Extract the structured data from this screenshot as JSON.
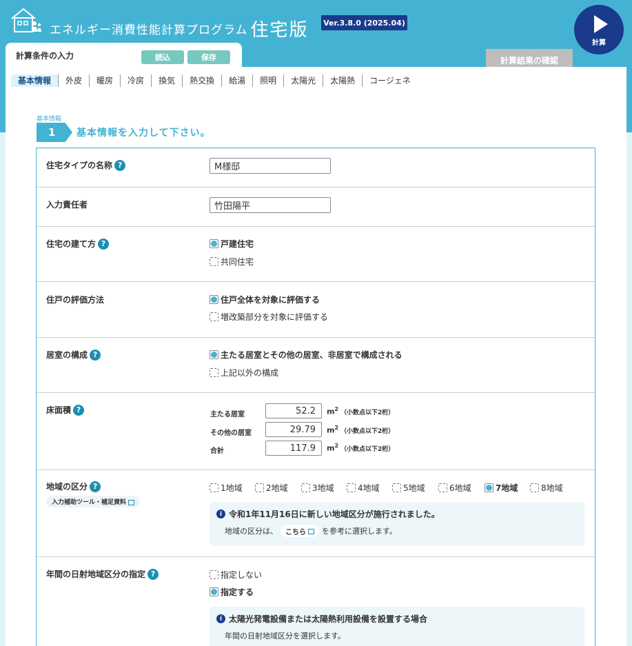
{
  "header": {
    "app_title": "エネルギー消費性能計算プログラム",
    "app_title_big": "住宅版",
    "version": "Ver.3.8.0 (2025.04)",
    "calc_button": "計算",
    "input_tab": "計算条件の入力",
    "load_button": "読込",
    "save_button": "保存",
    "result_button": "計算結果の確認"
  },
  "subtabs": [
    "基本情報",
    "外皮",
    "暖房",
    "冷房",
    "換気",
    "熱交換",
    "給湯",
    "照明",
    "太陽光",
    "太陽熱",
    "コージェネ"
  ],
  "section": {
    "small_label": "基本情報",
    "number": "1",
    "title": "基本情報を入力して下さい。"
  },
  "form": {
    "house_name": {
      "label": "住宅タイプの名称",
      "value": "M様邸"
    },
    "responsible": {
      "label": "入力責任者",
      "value": "竹田陽平"
    },
    "building_type": {
      "label": "住宅の建て方",
      "options": [
        "戸建住宅",
        "共同住宅"
      ]
    },
    "eval_method": {
      "label": "住戸の評価方法",
      "options": [
        "住戸全体を対象に評価する",
        "増改築部分を対象に評価する"
      ]
    },
    "room_config": {
      "label": "居室の構成",
      "options": [
        "主たる居室とその他の居室、非居室で構成される",
        "上記以外の構成"
      ]
    },
    "floor_area": {
      "label": "床面積",
      "rows": [
        {
          "label": "主たる居室",
          "value": "52.2"
        },
        {
          "label": "その他の居室",
          "value": "29.79"
        },
        {
          "label": "合計",
          "value": "117.9"
        }
      ],
      "unit": "m",
      "unit_sup": "2",
      "unit_note": "（小数点以下2桁）"
    },
    "region": {
      "label": "地域の区分",
      "tool_link": "入力補助ツール・補足資料",
      "options": [
        "1地域",
        "2地域",
        "3地域",
        "4地域",
        "5地域",
        "6地域",
        "7地域",
        "8地域"
      ],
      "info_title": "令和1年11月16日に新しい地域区分が施行されました。",
      "info_pre": "地域の区分は、",
      "info_link": "こちら",
      "info_post": "を参考に選択します。"
    },
    "solar_region": {
      "label": "年間の日射地域区分の指定",
      "options": [
        "指定しない",
        "指定する"
      ],
      "info_title": "太陽光発電設備または太陽熱利用設備を設置する場合",
      "info_body": "年間の日射地域区分を選択します。"
    }
  },
  "colors": {
    "header": "#44b3d3",
    "navy": "#1a3a8c",
    "teal_button": "#76c9c0"
  }
}
